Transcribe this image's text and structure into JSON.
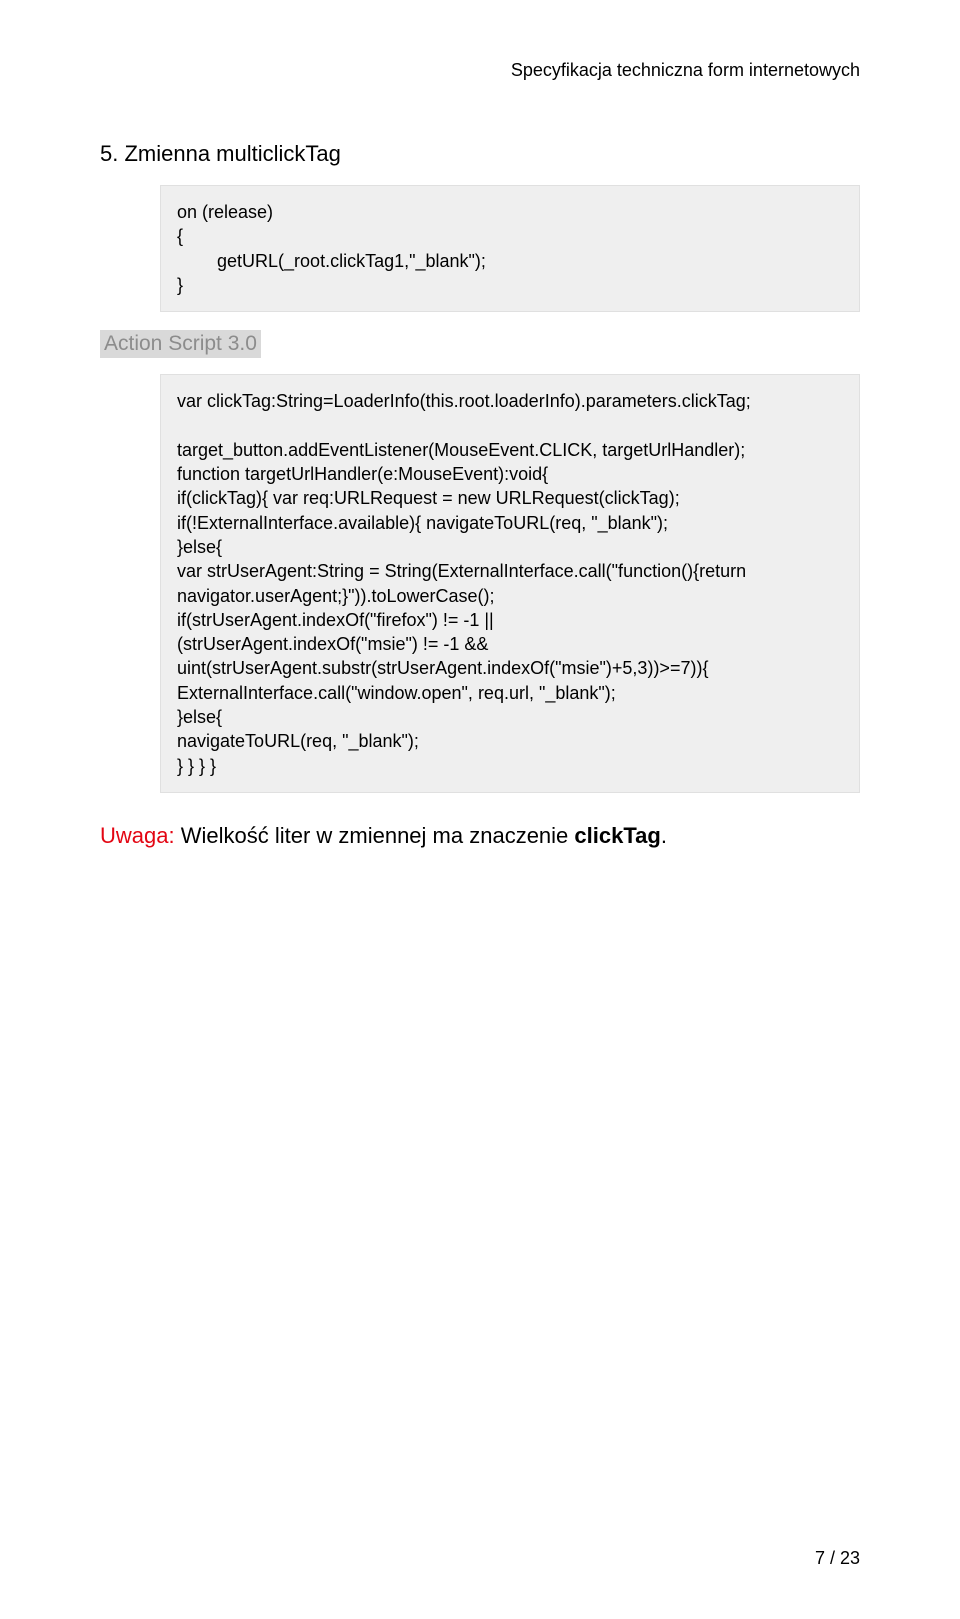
{
  "header": {
    "running": "Specyfikacja techniczna form internetowych"
  },
  "section": {
    "number_title": "5.  Zmienna multiclickTag"
  },
  "code1": "on (release)\n{\n        getURL(_root.clickTag1,\"_blank\");\n}",
  "label_as3": "Action Script 3.0",
  "code2": "var clickTag:String=LoaderInfo(this.root.loaderInfo).parameters.clickTag;\n\ntarget_button.addEventListener(MouseEvent.CLICK, targetUrlHandler);\nfunction targetUrlHandler(e:MouseEvent):void{\nif(clickTag){ var req:URLRequest = new URLRequest(clickTag);\nif(!ExternalInterface.available){ navigateToURL(req, \"_blank\");\n}else{\nvar strUserAgent:String = String(ExternalInterface.call(\"function(){return navigator.userAgent;}\")).toLowerCase();\nif(strUserAgent.indexOf(\"firefox\") != -1 ||\n(strUserAgent.indexOf(\"msie\") != -1 &&\nuint(strUserAgent.substr(strUserAgent.indexOf(\"msie\")+5,3))>=7)){\nExternalInterface.call(\"window.open\", req.url, \"_blank\");\n}else{\nnavigateToURL(req, \"_blank\");\n} } } }",
  "note": {
    "uwaga": "Uwaga:",
    "text_mid": " Wielkość liter w zmiennej ma znaczenie ",
    "bold": "clickTag",
    "tail": "."
  },
  "footer": {
    "page": "7 / 23"
  }
}
